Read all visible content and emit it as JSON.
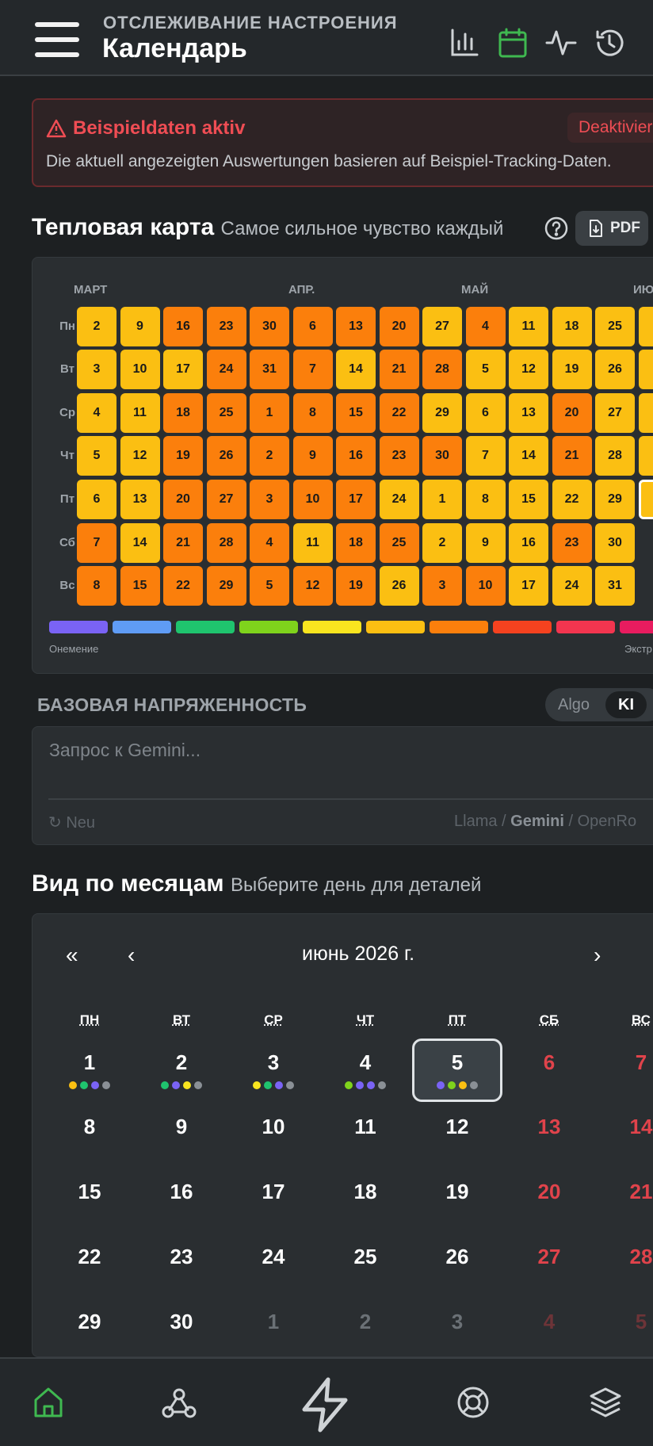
{
  "header": {
    "subtitle": "ОТСЛЕЖИВАНИЕ НАСТРОЕНИЯ",
    "title": "Календарь",
    "icons": [
      "bar-chart-icon",
      "calendar-icon",
      "activity-icon",
      "history-icon"
    ],
    "active_icon_color": "#3fb950"
  },
  "banner": {
    "title": "Beispieldaten aktiv",
    "button": "Deaktivier",
    "text": "Die aktuell angezeigten Auswertungen basieren auf Beispiel-Tracking-Daten."
  },
  "heatmap": {
    "title": "Тепловая карта",
    "subtitle": "Самое сильное чувство каждый",
    "pdf_label": "PDF",
    "months": [
      "МАРТ",
      "АПР.",
      "МАЙ",
      "ИЮ"
    ],
    "weekdays": [
      "Пн",
      "Вт",
      "Ср",
      "Чт",
      "Пт",
      "Сб",
      "Вс"
    ],
    "colors": {
      "yellow": "#fbbf12",
      "orange": "#fb7f0c"
    },
    "columns": [
      [
        {
          "d": "2",
          "c": "y"
        },
        {
          "d": "3",
          "c": "y"
        },
        {
          "d": "4",
          "c": "y"
        },
        {
          "d": "5",
          "c": "y"
        },
        {
          "d": "6",
          "c": "y"
        },
        {
          "d": "7",
          "c": "o"
        },
        {
          "d": "8",
          "c": "o"
        }
      ],
      [
        {
          "d": "9",
          "c": "y"
        },
        {
          "d": "10",
          "c": "y"
        },
        {
          "d": "11",
          "c": "y"
        },
        {
          "d": "12",
          "c": "y"
        },
        {
          "d": "13",
          "c": "y"
        },
        {
          "d": "14",
          "c": "y"
        },
        {
          "d": "15",
          "c": "o"
        }
      ],
      [
        {
          "d": "16",
          "c": "o"
        },
        {
          "d": "17",
          "c": "y"
        },
        {
          "d": "18",
          "c": "o"
        },
        {
          "d": "19",
          "c": "o"
        },
        {
          "d": "20",
          "c": "o"
        },
        {
          "d": "21",
          "c": "o"
        },
        {
          "d": "22",
          "c": "o"
        }
      ],
      [
        {
          "d": "23",
          "c": "o"
        },
        {
          "d": "24",
          "c": "o"
        },
        {
          "d": "25",
          "c": "o"
        },
        {
          "d": "26",
          "c": "o"
        },
        {
          "d": "27",
          "c": "o"
        },
        {
          "d": "28",
          "c": "o"
        },
        {
          "d": "29",
          "c": "o"
        }
      ],
      [
        {
          "d": "30",
          "c": "o"
        },
        {
          "d": "31",
          "c": "o"
        },
        {
          "d": "1",
          "c": "o"
        },
        {
          "d": "2",
          "c": "o"
        },
        {
          "d": "3",
          "c": "o"
        },
        {
          "d": "4",
          "c": "o"
        },
        {
          "d": "5",
          "c": "o"
        }
      ],
      [
        {
          "d": "6",
          "c": "o"
        },
        {
          "d": "7",
          "c": "o"
        },
        {
          "d": "8",
          "c": "o"
        },
        {
          "d": "9",
          "c": "o"
        },
        {
          "d": "10",
          "c": "o"
        },
        {
          "d": "11",
          "c": "y"
        },
        {
          "d": "12",
          "c": "o"
        }
      ],
      [
        {
          "d": "13",
          "c": "o"
        },
        {
          "d": "14",
          "c": "y"
        },
        {
          "d": "15",
          "c": "o"
        },
        {
          "d": "16",
          "c": "o"
        },
        {
          "d": "17",
          "c": "o"
        },
        {
          "d": "18",
          "c": "o"
        },
        {
          "d": "19",
          "c": "o"
        }
      ],
      [
        {
          "d": "20",
          "c": "o"
        },
        {
          "d": "21",
          "c": "o"
        },
        {
          "d": "22",
          "c": "o"
        },
        {
          "d": "23",
          "c": "o"
        },
        {
          "d": "24",
          "c": "y"
        },
        {
          "d": "25",
          "c": "o"
        },
        {
          "d": "26",
          "c": "y"
        }
      ],
      [
        {
          "d": "27",
          "c": "y"
        },
        {
          "d": "28",
          "c": "o"
        },
        {
          "d": "29",
          "c": "y"
        },
        {
          "d": "30",
          "c": "o"
        },
        {
          "d": "1",
          "c": "y"
        },
        {
          "d": "2",
          "c": "y"
        },
        {
          "d": "3",
          "c": "o"
        }
      ],
      [
        {
          "d": "4",
          "c": "o"
        },
        {
          "d": "5",
          "c": "y"
        },
        {
          "d": "6",
          "c": "y"
        },
        {
          "d": "7",
          "c": "y"
        },
        {
          "d": "8",
          "c": "y"
        },
        {
          "d": "9",
          "c": "y"
        },
        {
          "d": "10",
          "c": "o"
        }
      ],
      [
        {
          "d": "11",
          "c": "y"
        },
        {
          "d": "12",
          "c": "y"
        },
        {
          "d": "13",
          "c": "y"
        },
        {
          "d": "14",
          "c": "y"
        },
        {
          "d": "15",
          "c": "y"
        },
        {
          "d": "16",
          "c": "y"
        },
        {
          "d": "17",
          "c": "y"
        }
      ],
      [
        {
          "d": "18",
          "c": "y"
        },
        {
          "d": "19",
          "c": "y"
        },
        {
          "d": "20",
          "c": "o"
        },
        {
          "d": "21",
          "c": "o"
        },
        {
          "d": "22",
          "c": "y"
        },
        {
          "d": "23",
          "c": "o"
        },
        {
          "d": "24",
          "c": "y"
        }
      ],
      [
        {
          "d": "25",
          "c": "y"
        },
        {
          "d": "26",
          "c": "y"
        },
        {
          "d": "27",
          "c": "y"
        },
        {
          "d": "28",
          "c": "y"
        },
        {
          "d": "29",
          "c": "y"
        },
        {
          "d": "30",
          "c": "y"
        },
        {
          "d": "31",
          "c": "y"
        }
      ],
      [
        {
          "d": "",
          "c": "y"
        },
        {
          "d": "",
          "c": "y"
        },
        {
          "d": "",
          "c": "y"
        },
        {
          "d": "",
          "c": "y"
        },
        {
          "d": "",
          "c": "y",
          "sel": true
        },
        null,
        null
      ]
    ],
    "legend_colors": [
      "#7a63f5",
      "#5f9cf5",
      "#1fc46e",
      "#7fd31c",
      "#f9e51f",
      "#fbbf12",
      "#fb7f0c",
      "#f5421f",
      "#f2354f",
      "#e81c5f"
    ],
    "legend_left": "Онемение",
    "legend_right": "Экстр"
  },
  "baseline": {
    "title": "БАЗОВАЯ НАПРЯЖЕННОСТЬ",
    "toggle_algo": "Algo",
    "toggle_ki": "KI",
    "placeholder": "Запрос к Gemini...",
    "new_label": "Neu",
    "models": [
      "Llama",
      "Gemini",
      "OpenRo"
    ]
  },
  "month_view": {
    "title": "Вид по месяцам",
    "subtitle": "Выберите день для деталей",
    "nav_prev_year": "«",
    "nav_prev": "‹",
    "nav_next": "›",
    "month_label": "июнь 2026 г.",
    "weekdays": [
      "ПН",
      "ВТ",
      "СР",
      "ЧТ",
      "ПТ",
      "СБ",
      "ВС"
    ],
    "weeks": [
      [
        "1",
        "2",
        "3",
        "4",
        "5",
        "6",
        "7"
      ],
      [
        "8",
        "9",
        "10",
        "11",
        "12",
        "13",
        "14"
      ],
      [
        "15",
        "16",
        "17",
        "18",
        "19",
        "20",
        "21"
      ],
      [
        "22",
        "23",
        "24",
        "25",
        "26",
        "27",
        "28"
      ],
      [
        "29",
        "30",
        "1",
        "2",
        "3",
        "4",
        "5"
      ]
    ],
    "other_month_from": 2,
    "selected_day": "5",
    "day_dots": [
      [
        "#fbbf12",
        "#1fc46e",
        "#7a63f5",
        "#8a9096"
      ],
      [
        "#1fc46e",
        "#7a63f5",
        "#f9e51f",
        "#8a9096"
      ],
      [
        "#f9e51f",
        "#1fc46e",
        "#7a63f5",
        "#8a9096"
      ],
      [
        "#7fd31c",
        "#7a63f5",
        "#7a63f5",
        "#8a9096"
      ],
      [
        "#7a63f5",
        "#7fd31c",
        "#fbbf12",
        "#8a9096"
      ]
    ]
  },
  "bottom_nav": {
    "icons": [
      "home-icon",
      "webhook-icon",
      "lightning-icon",
      "lifebuoy-icon",
      "layers-icon"
    ],
    "active_color": "#3fb950"
  }
}
